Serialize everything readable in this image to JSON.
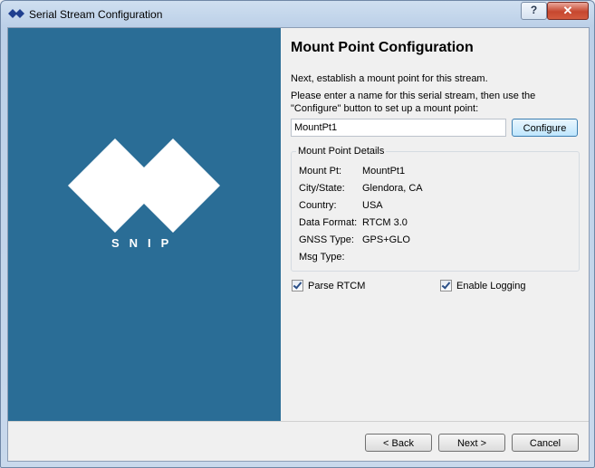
{
  "window": {
    "title": "Serial Stream Configuration",
    "help_label": "?",
    "close_label": "✕"
  },
  "logo": {
    "text": "SNIP"
  },
  "page": {
    "heading": "Mount Point Configuration",
    "intro": "Next, establish a mount point for this stream.",
    "instructions": "Please enter a name for this serial stream, then use the \"Configure\" button to set up a mount point:"
  },
  "mount_name": {
    "value": "MountPt1"
  },
  "buttons": {
    "configure": "Configure",
    "back": "< Back",
    "next": "Next >",
    "cancel": "Cancel"
  },
  "details": {
    "title": "Mount Point Details",
    "rows": [
      {
        "label": "Mount Pt:",
        "value": "MountPt1"
      },
      {
        "label": "City/State:",
        "value": "Glendora, CA"
      },
      {
        "label": "Country:",
        "value": "USA"
      },
      {
        "label": "Data Format:",
        "value": "RTCM 3.0"
      },
      {
        "label": "GNSS Type:",
        "value": "GPS+GLO"
      },
      {
        "label": "Msg Type:",
        "value": ""
      }
    ]
  },
  "options": {
    "parse_rtcm": "Parse RTCM",
    "enable_logging": "Enable Logging"
  },
  "colors": {
    "panel": "#2a6d96"
  }
}
